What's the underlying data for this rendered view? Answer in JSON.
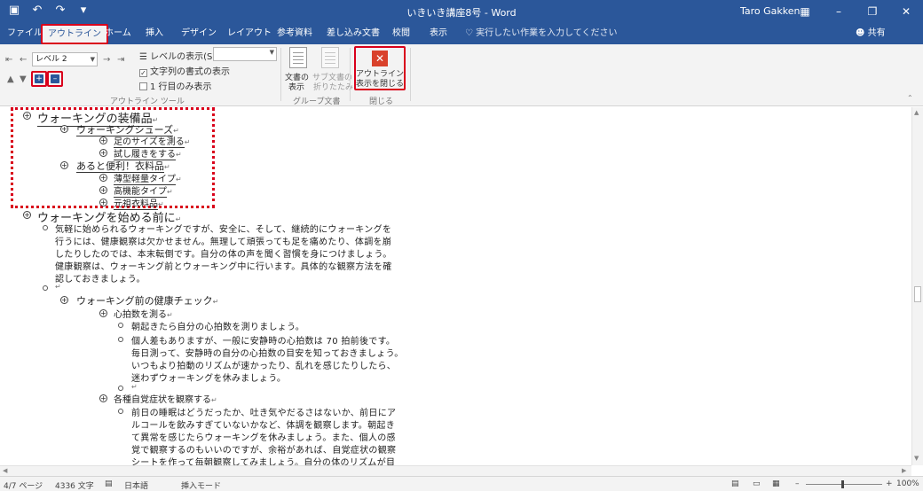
{
  "titlebar": {
    "save_icon": "save-icon",
    "title": "いきいき講座8号 - Word",
    "user": "Taro Gakken",
    "buttons": [
      "ribbon-display-icon",
      "minimize-icon",
      "maximize-icon",
      "close-icon"
    ]
  },
  "tabs": [
    {
      "label": "ファイル"
    },
    {
      "label": "アウトライン"
    },
    {
      "label": "ホーム"
    },
    {
      "label": "挿入"
    },
    {
      "label": "デザイン"
    },
    {
      "label": "レイアウト"
    },
    {
      "label": "参考資料"
    },
    {
      "label": "差し込み文書"
    },
    {
      "label": "校閲"
    },
    {
      "label": "表示"
    }
  ],
  "tell_me": "♡ 実行したい作業を入力してください",
  "share": "共有",
  "ribbon": {
    "level_value": "レベル 2",
    "show_level_label": "レベルの表示(S):",
    "show_format_label": "文字列の書式の表示",
    "first_line_label": "1 行目のみ表示",
    "outline_tools_label": "アウトライン ツール",
    "show_document_label_1": "文書の",
    "show_document_label_2": "表示",
    "collapse_sub_label_1": "サブ文書の",
    "collapse_sub_label_2": "折りたたみ",
    "master_group_label": "グループ文書",
    "close_label_1": "アウトライン",
    "close_label_2": "表示を閉じる",
    "close_group_label": "閉じる"
  },
  "document": {
    "h1_a": "ウォーキングの装備品",
    "h2_a": "ウォーキングシューズ",
    "h3_a1": "足のサイズを測る",
    "h3_a2": "試し履きをする",
    "h2_b": "あると便利！衣料品",
    "h3_b1": "薄型軽量タイプ",
    "h3_b2": "高機能タイプ",
    "h3_b3": "元祖衣料品",
    "h1_b": "ウォーキングを始める前に",
    "p1_l1": "気軽に始められるウォーキングですが、安全に、そして、継続的にウォーキングを",
    "p1_l2": "行うには、健康観察は欠かせません。無理して頑張っても足を痛めたり、体調を崩",
    "p1_l3": "したりしたのでは、本末転倒です。自分の体の声を聞く習慣を身につけましょう。",
    "p1_l4": "健康観察は、ウォーキング前とウォーキング中に行います。具体的な観察方法を確",
    "p1_l5": "認しておきましょう。",
    "h2_c": "ウォーキング前の健康チェック",
    "h3_c1": "心拍数を測る",
    "p2": "朝起きたら自分の心拍数を測りましょう。",
    "p3_l1": "個人差もありますが、一般に安静時の心拍数は 70 拍前後です。",
    "p3_l2": "毎日測って、安静時の自分の心拍数の目安を知っておきましょう。",
    "p3_l3": "いつもより拍動のリズムが速かったり、乱れを感じたりしたら、",
    "p3_l4": "迷わずウォーキングを休みましょう。",
    "h3_c2": "各種自覚症状を観察する",
    "p4_l1": "前日の睡眠はどうだったか、吐き気やだるさはないか、前日にア",
    "p4_l2": "ルコールを飲みすぎていないかなど、体調を観察します。朝起き",
    "p4_l3": "て異常を感じたらウォーキングを休みましょう。また、個人の感",
    "p4_l4": "覚で観察するのもいいのですが、余裕があれば、自覚症状の観察",
    "p4_l5": "シートを作って毎朝観察してみましょう。自分の体のリズムが目"
  },
  "status": {
    "page": "4/7 ページ",
    "words": "4336 文字",
    "language": "日本語",
    "mode": "挿入モード",
    "zoom": "100%"
  },
  "colors": {
    "accent": "#2b579a",
    "highlight": "#d9001b"
  }
}
